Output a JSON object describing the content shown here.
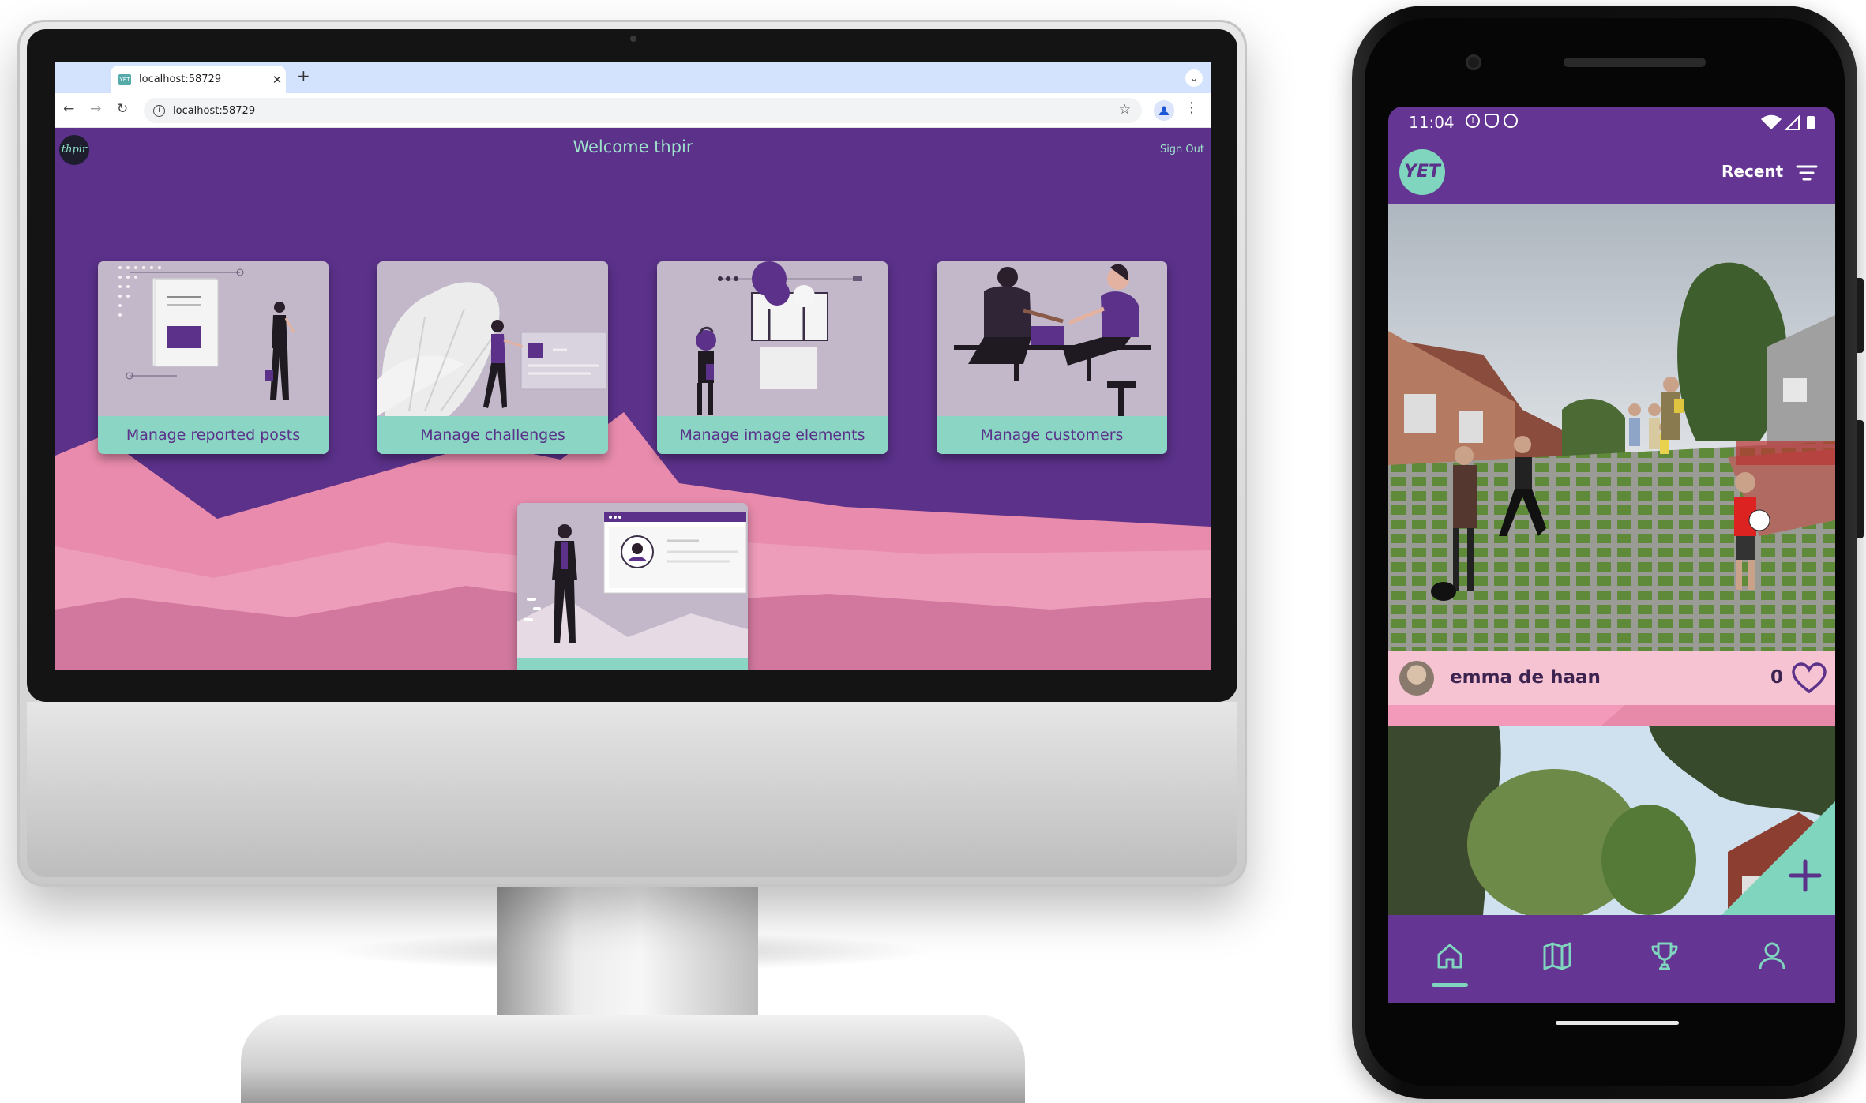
{
  "browser": {
    "tab_title": "localhost:58729",
    "tab_favicon_text": "YET",
    "new_tab_symbol": "+",
    "url": "localhost:58729"
  },
  "admin_app": {
    "logo_text": "thpir",
    "welcome": "Welcome thpir",
    "sign_out": "Sign Out",
    "cards": [
      {
        "label": "Manage reported posts"
      },
      {
        "label": "Manage challenges"
      },
      {
        "label": "Manage image elements"
      },
      {
        "label": "Manage customers"
      },
      {
        "label": ""
      }
    ]
  },
  "phone": {
    "status_time": "11:04",
    "logo_text": "YET",
    "sort_label": "Recent",
    "post": {
      "username": "emma de haan",
      "likes": "0"
    },
    "fab_symbol": "+",
    "nav_items": [
      "home-icon",
      "map-icon",
      "trophy-icon",
      "profile-icon"
    ]
  },
  "colors": {
    "purple": "#5b318a",
    "phone_purple": "#643592",
    "mint": "#8ad5c3",
    "pink": "#f6c3d3",
    "card_bg": "#c2b8c9"
  }
}
